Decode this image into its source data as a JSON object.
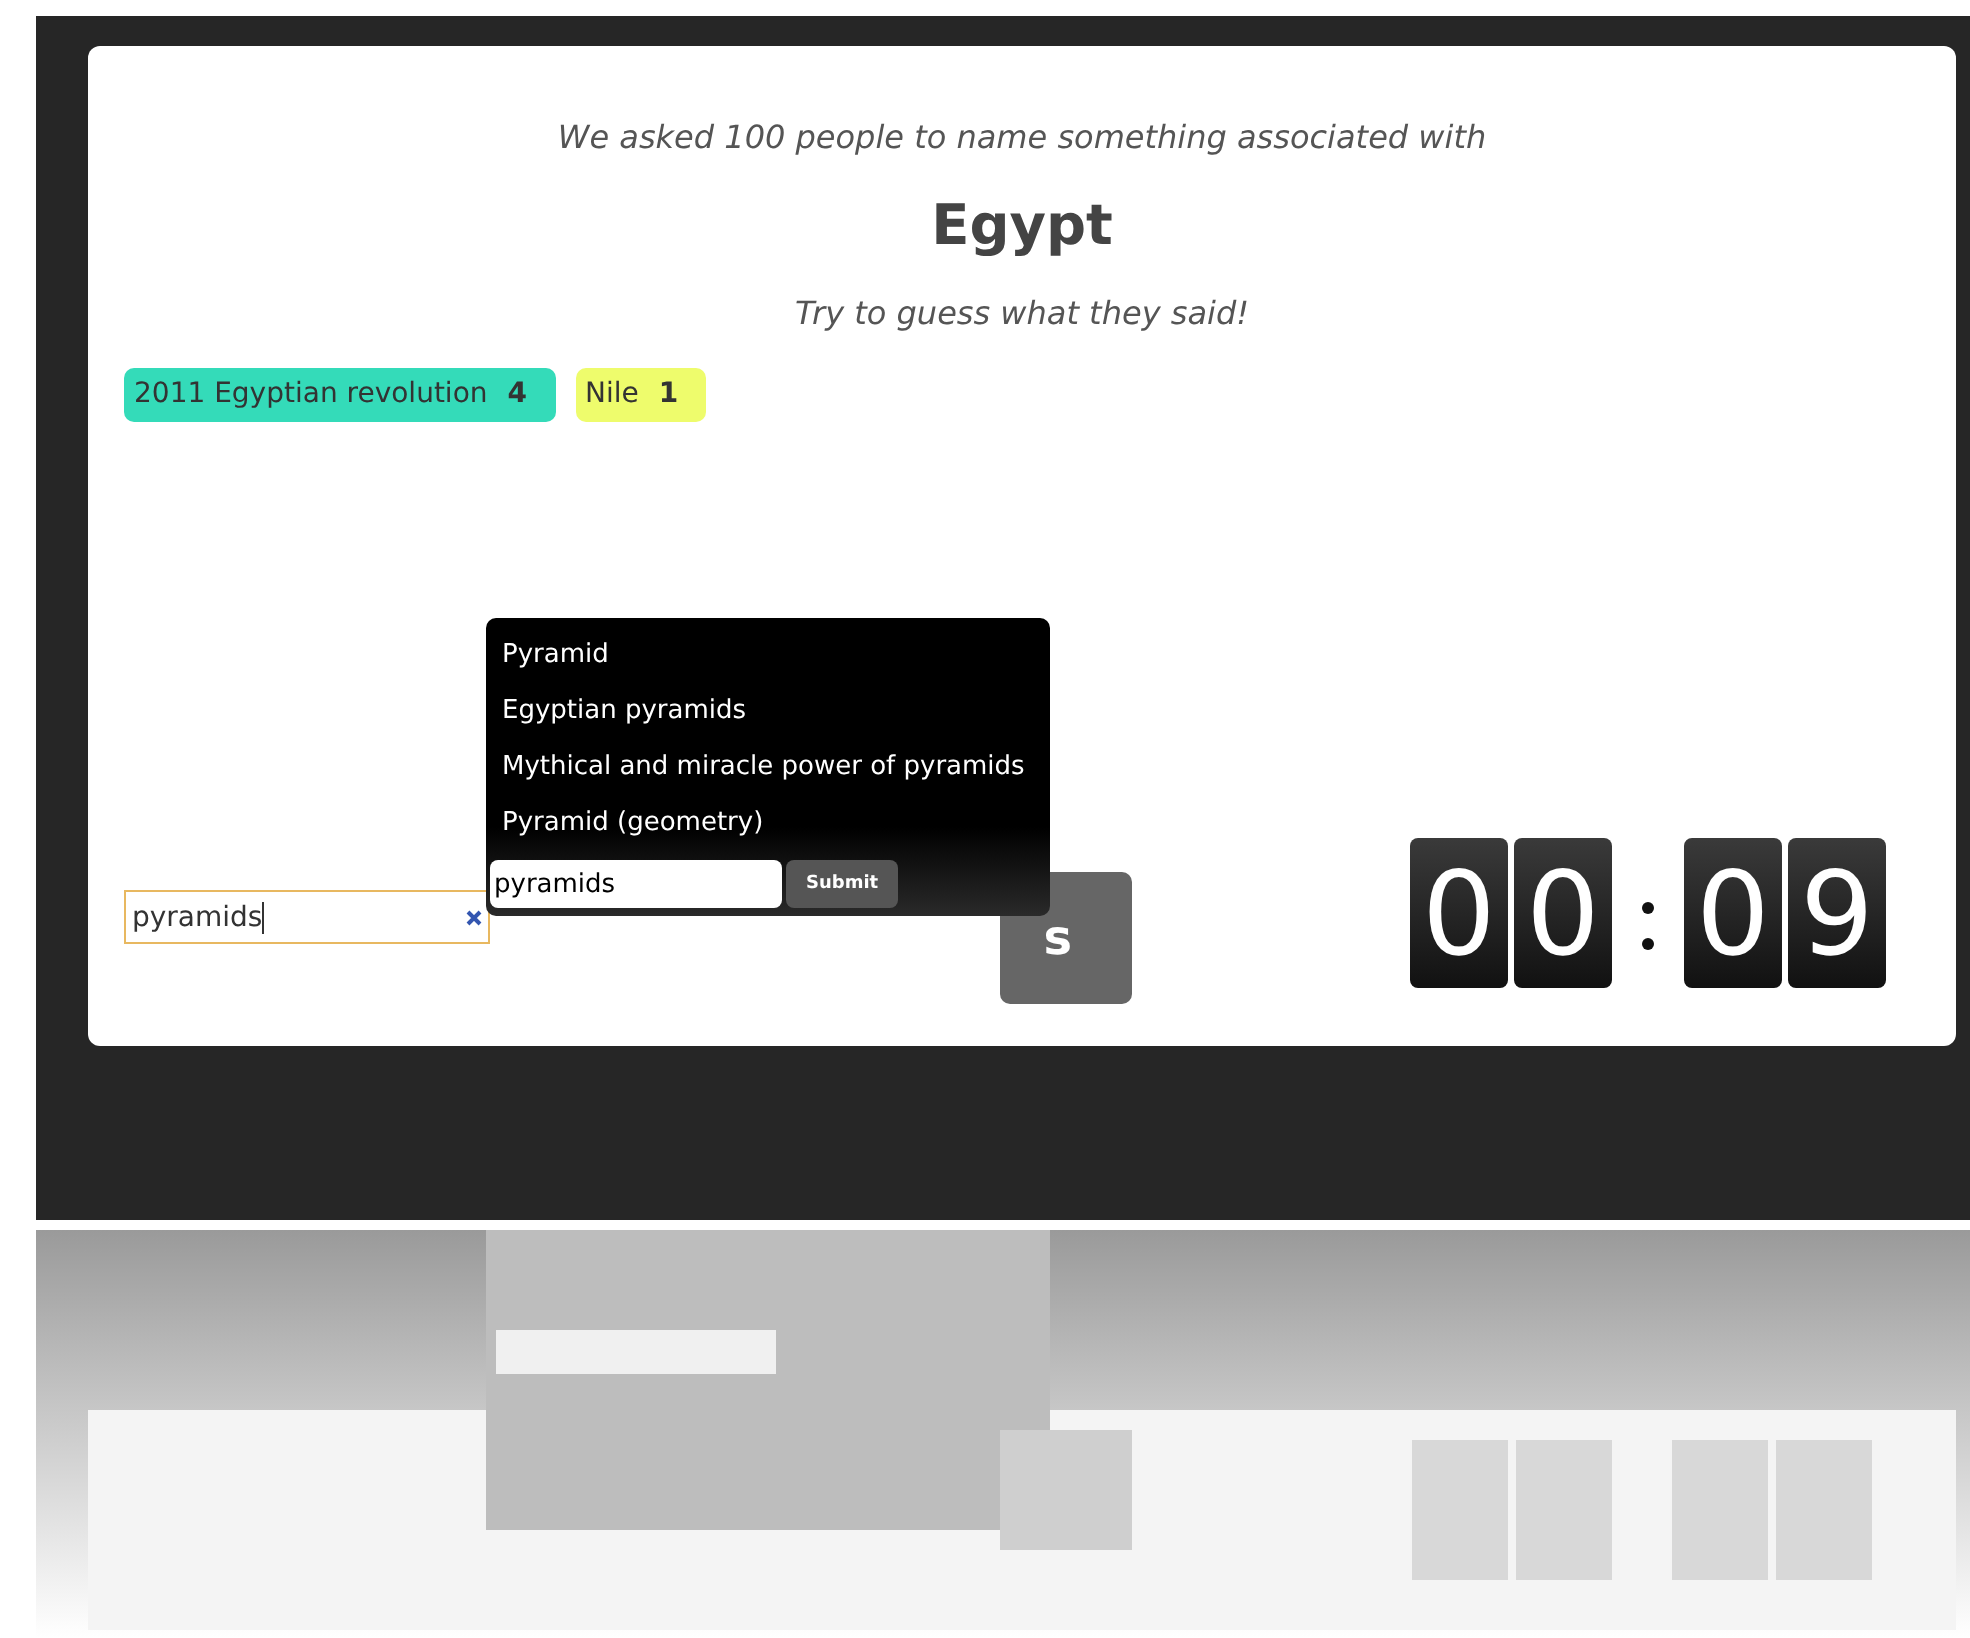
{
  "intro": "We asked 100 people to name something associated with",
  "topic": "Egypt",
  "prompt": "Try to guess what they said!",
  "answers": [
    {
      "label": "2011 Egyptian revolution",
      "count": "4",
      "color": "#34dbb9"
    },
    {
      "label": "Nile",
      "count": "1",
      "color": "#eefc6c"
    }
  ],
  "guess_field": {
    "value": "pyramids"
  },
  "guess_button": {
    "label": "s"
  },
  "suggestions": {
    "items": [
      {
        "label": "Pyramid"
      },
      {
        "label": "Egyptian pyramids"
      },
      {
        "label": "Mythical and miracle power of pyramids"
      },
      {
        "label": "Pyramid (geometry)"
      }
    ],
    "field": {
      "value": "pyramids"
    },
    "submit": "Submit"
  },
  "timer": {
    "digits": [
      "0",
      "0",
      "0",
      "9"
    ]
  }
}
